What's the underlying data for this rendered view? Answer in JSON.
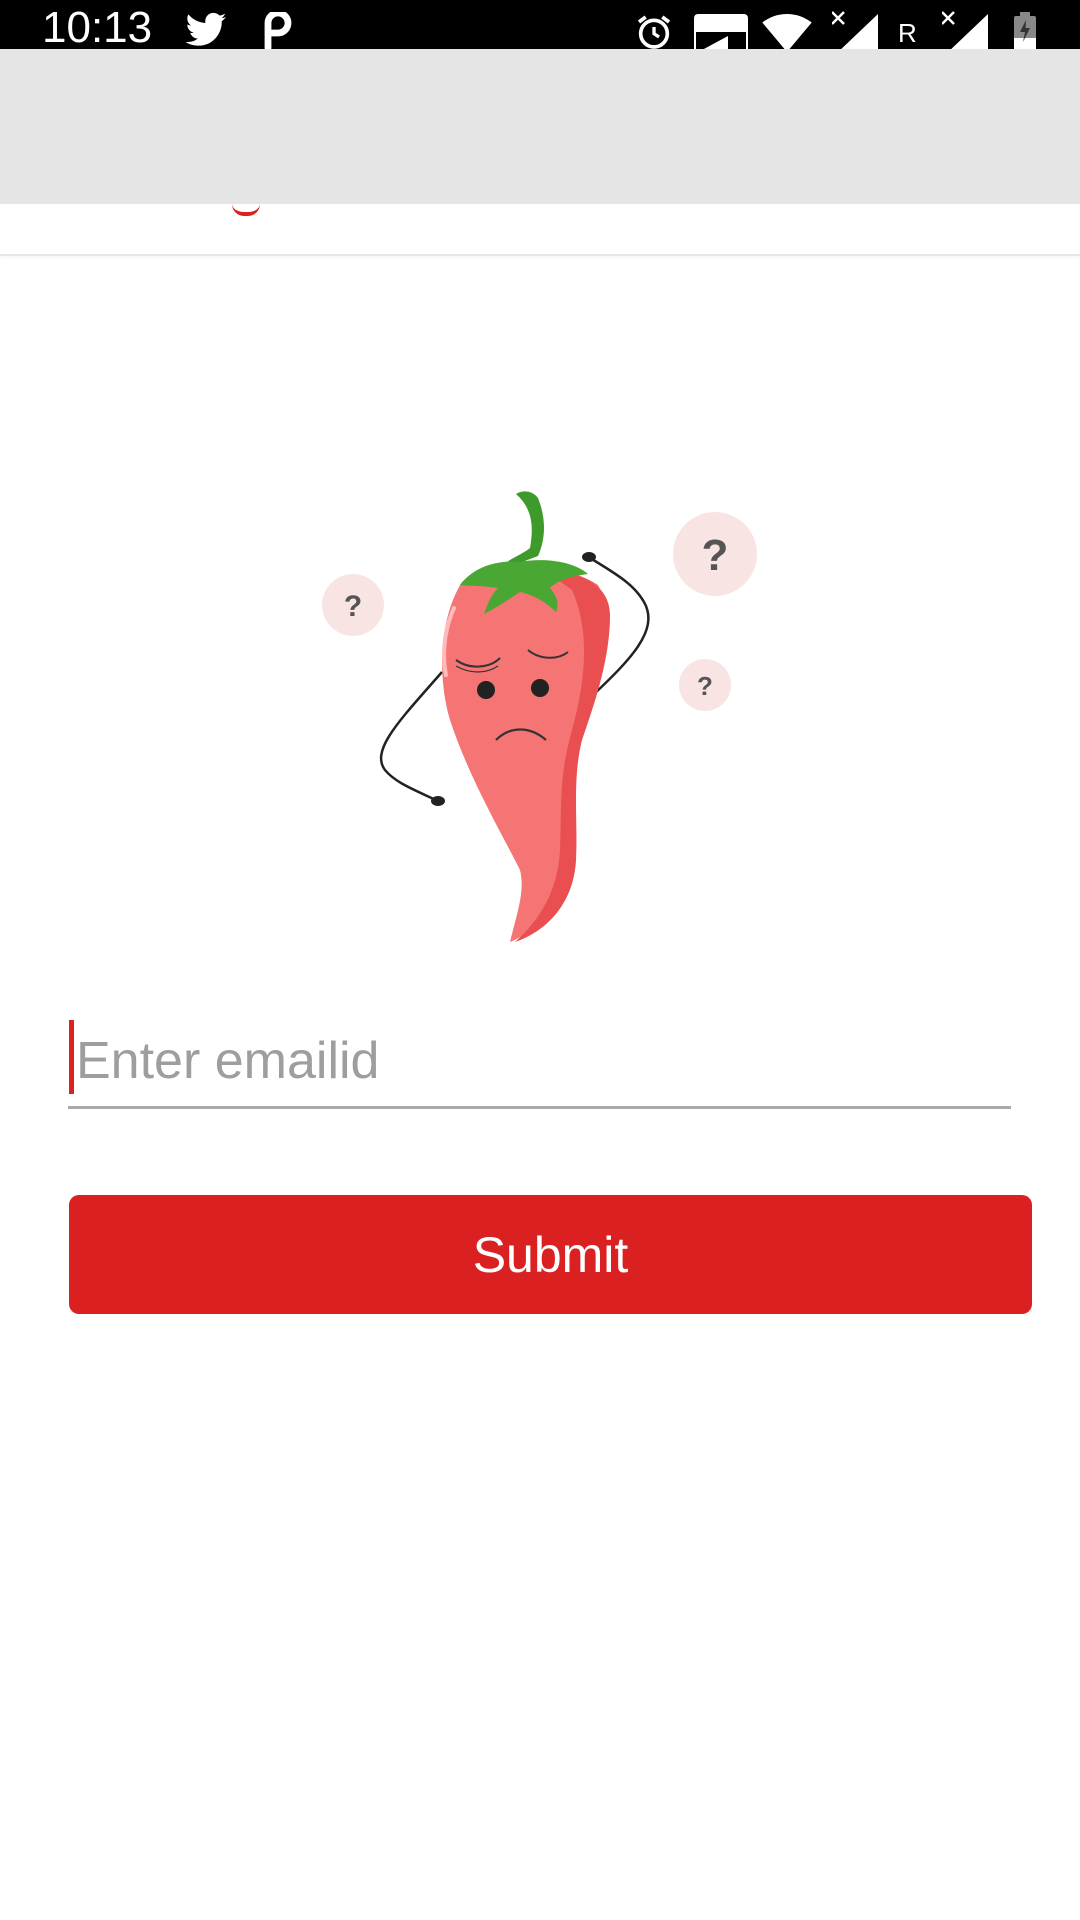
{
  "status_bar": {
    "time": "10:13",
    "icons": [
      "twitter-icon",
      "p-app-icon",
      "alarm-icon",
      "volte-icon",
      "wifi-icon",
      "signal-icon",
      "signal-icon",
      "battery-icon"
    ],
    "volte_label": "VOLTE",
    "roaming_label": "R"
  },
  "email": {
    "placeholder": "Enter emailid",
    "value": ""
  },
  "submit": {
    "label": "Submit"
  },
  "illustration": {
    "question_mark": "?"
  },
  "colors": {
    "accent": "#db2021",
    "app_bar": "#e5e5e5",
    "pepper": "#f57474",
    "stem": "#3f9a2c"
  }
}
